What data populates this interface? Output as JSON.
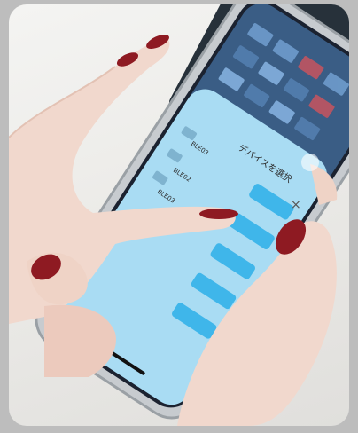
{
  "photo": {
    "description_tag": "hand-holding-phone"
  },
  "phone": {
    "sheet_title": "デバイスを選択",
    "device_rows": [
      "BLE03",
      "BLE02",
      "BLE03"
    ],
    "close_glyph": "×",
    "colors": {
      "sheet": "#a9dcf3",
      "button": "#3fb6ea",
      "nail": "#8e1a22",
      "skin": "#f0d6cb"
    }
  }
}
